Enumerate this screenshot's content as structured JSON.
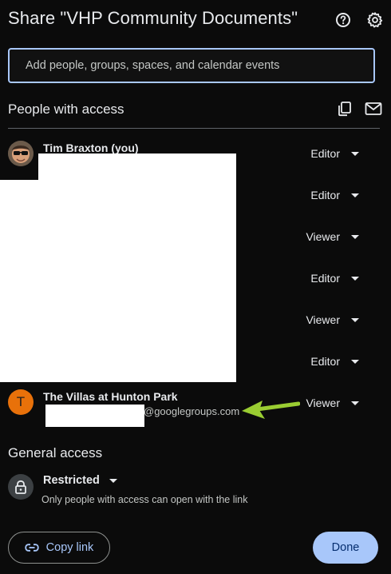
{
  "header": {
    "title": "Share \"VHP Community Documents\"",
    "help_icon": "help-circle-icon",
    "settings_icon": "gear-icon"
  },
  "search": {
    "placeholder": "Add people, groups, spaces, and calendar events"
  },
  "people_section": {
    "title": "People with access",
    "copy_icon": "copy-emails-icon",
    "email_icon": "email-icon",
    "people": [
      {
        "name": "Tim Braxton (you)",
        "email": "",
        "role": "Editor"
      },
      {
        "name": "",
        "email": "",
        "role": "Editor"
      },
      {
        "name": "",
        "email": "",
        "role": "Viewer"
      },
      {
        "name": "",
        "email": "",
        "role": "Editor"
      },
      {
        "name": "",
        "email": "",
        "role": "Viewer"
      },
      {
        "name": "",
        "email": "",
        "role": "Editor"
      },
      {
        "name": "The Villas at Hunton Park",
        "email": "@googlegroups.com",
        "role": "Viewer",
        "avatar_letter": "T"
      }
    ]
  },
  "general_access": {
    "title": "General access",
    "level": "Restricted",
    "description": "Only people with access can open with the link"
  },
  "footer": {
    "copy_link_label": "Copy link",
    "done_label": "Done"
  },
  "colors": {
    "background": "#0b0b0b",
    "accent": "#a8c7fa",
    "avatar_orange": "#e8710a",
    "annotation_arrow": "#9acd32"
  }
}
